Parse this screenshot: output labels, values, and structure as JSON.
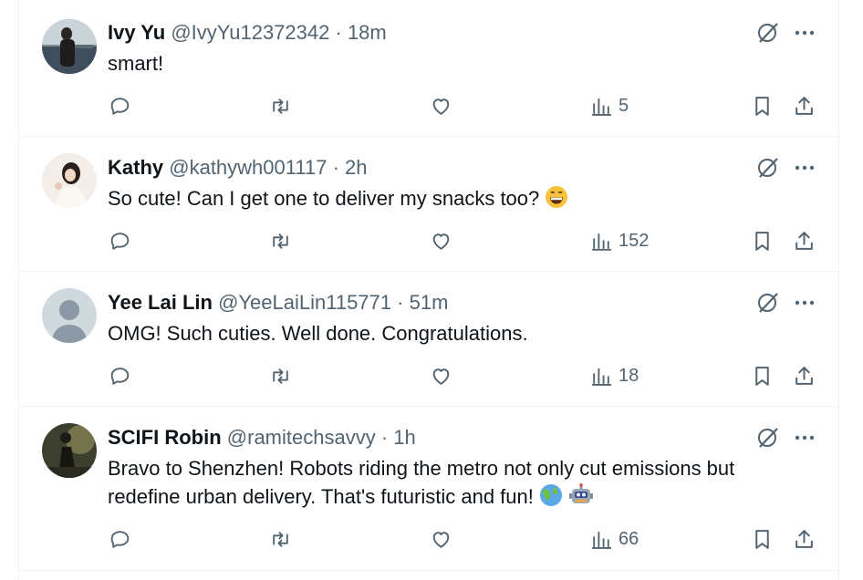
{
  "tweets": [
    {
      "name": "Ivy Yu",
      "handle": "@IvyYu12372342",
      "separator": "·",
      "time": "18m",
      "text": "smart!",
      "views": "5"
    },
    {
      "name": "Kathy",
      "handle": "@kathywh001117",
      "separator": "·",
      "time": "2h",
      "text": "So cute! Can I get one to deliver my snacks too?",
      "views": "152"
    },
    {
      "name": "Yee Lai Lin",
      "handle": "@YeeLaiLin115771",
      "separator": "·",
      "time": "51m",
      "text": "OMG! Such cuties. Well done. Congratulations.",
      "views": "18"
    },
    {
      "name": "SCIFI Robin",
      "handle": "@ramitechsavvy",
      "separator": "·",
      "time": "1h",
      "text_line1": "Bravo to Shenzhen! Robots riding the metro not only cut emissions but",
      "text_line2": "redefine urban delivery. That's futuristic and fun!",
      "views": "66"
    }
  ],
  "colors": {
    "text": "#0f1419",
    "secondary": "#536471",
    "divider": "#eff3f4"
  },
  "icons": [
    "reply-icon",
    "retweet-icon",
    "like-icon",
    "views-icon",
    "bookmark-icon",
    "share-icon",
    "grok-icon",
    "more-icon",
    "grinning-emoji",
    "globe-emoji",
    "robot-emoji"
  ]
}
